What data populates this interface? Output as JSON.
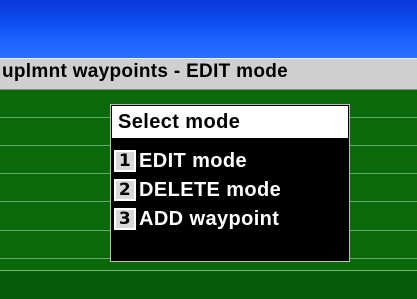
{
  "window": {
    "title": "uplmnt waypoints - EDIT mode"
  },
  "menu": {
    "header": "Select mode",
    "items": [
      {
        "key": "1",
        "label": "EDIT mode"
      },
      {
        "key": "2",
        "label": "DELETE mode"
      },
      {
        "key": "3",
        "label": "ADD waypoint"
      }
    ]
  },
  "colors": {
    "top_bar": "#1c62ff",
    "title_bar": "#cfcfcf",
    "workspace": "#0a6a0a",
    "menu_bg": "#000000",
    "menu_header_bg": "#ffffff"
  }
}
